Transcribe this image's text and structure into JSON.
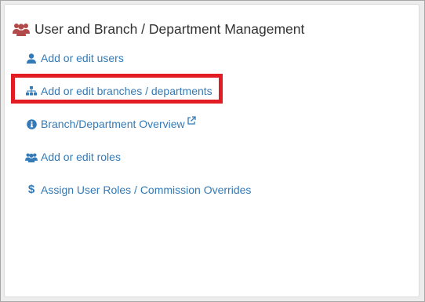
{
  "panel": {
    "title": "User and Branch / Department Management",
    "title_icon": "users-icon",
    "title_icon_color": "#b34a4a"
  },
  "menu": {
    "items": [
      {
        "label": "Add or edit users",
        "icon": "user-icon"
      },
      {
        "label": "Add or edit branches / departments",
        "icon": "sitemap-icon",
        "highlighted": true
      },
      {
        "label": "Branch/Department Overview",
        "icon": "info-circle-icon",
        "external": true
      },
      {
        "label": "Add or edit roles",
        "icon": "users-icon"
      },
      {
        "label": "Assign User Roles / Commission Overrides",
        "icon": "dollar-icon",
        "icon_text": "$"
      }
    ]
  },
  "colors": {
    "link": "#337ab7",
    "highlight": "#e31b23",
    "title_text": "#333333"
  }
}
